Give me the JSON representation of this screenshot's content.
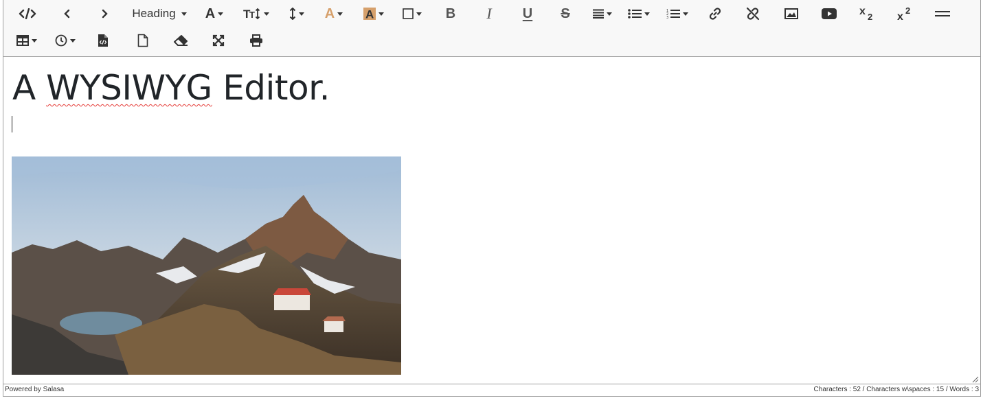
{
  "toolbar": {
    "heading_label": "Heading",
    "icons_row1": [
      "code-view-icon",
      "undo-icon",
      "redo-icon",
      "heading-select",
      "font-family-icon",
      "font-size-icon",
      "line-height-icon",
      "font-color-icon",
      "highlight-color-icon",
      "border-icon",
      "bold-icon",
      "italic-icon",
      "underline-icon",
      "strikethrough-icon",
      "align-icon",
      "bullet-list-icon",
      "numbered-list-icon",
      "link-icon",
      "unlink-icon",
      "image-icon",
      "video-icon",
      "subscript-icon",
      "superscript-icon",
      "horizontal-rule-icon"
    ],
    "icons_row2": [
      "table-icon",
      "history-icon",
      "source-file-icon",
      "new-document-icon",
      "eraser-icon",
      "fullscreen-icon",
      "print-icon"
    ],
    "font_color": "#d6a06b",
    "highlight_color": "#d6a06b"
  },
  "content": {
    "heading_pre": "A ",
    "heading_misspelled": "WYSIWYG",
    "heading_post": " Editor."
  },
  "status": {
    "powered_by": "Powered by Salasa",
    "counts": "Characters : 52 / Characters w\\spaces : 15 / Words : 3"
  }
}
